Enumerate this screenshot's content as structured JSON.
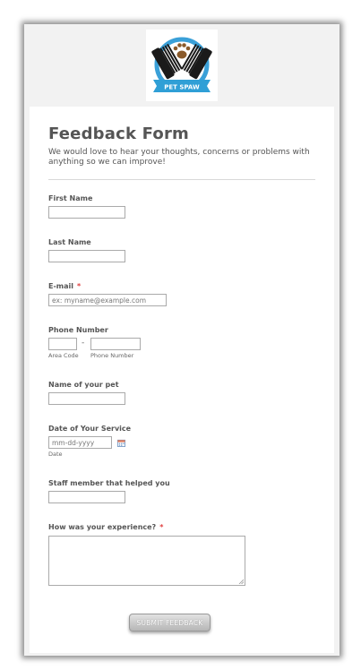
{
  "brand": {
    "logo_text": "PET SPAW",
    "ring_color": "#3aa0d8",
    "ribbon_color": "#2f9fd6"
  },
  "form": {
    "title": "Feedback Form",
    "subtitle": "We would love to hear your thoughts, concerns or problems with anything so we can improve!",
    "required_mark": "*",
    "fields": {
      "first_name": {
        "label": "First Name",
        "value": ""
      },
      "last_name": {
        "label": "Last Name",
        "value": ""
      },
      "email": {
        "label": "E-mail",
        "placeholder": "ex: myname@example.com",
        "value": ""
      },
      "phone": {
        "label": "Phone Number",
        "separator": "-",
        "area_code_label": "Area Code",
        "phone_number_label": "Phone Number"
      },
      "pet_name": {
        "label": "Name of your pet",
        "value": ""
      },
      "service_date": {
        "label": "Date of Your Service",
        "placeholder": "mm-dd-yyyy",
        "sublabel": "Date",
        "icon": "calendar-icon"
      },
      "staff": {
        "label": "Staff member that helped you",
        "value": ""
      },
      "experience": {
        "label": "How was your experience?",
        "value": ""
      }
    },
    "submit_label": "SUBMIT FEEDBACK"
  }
}
